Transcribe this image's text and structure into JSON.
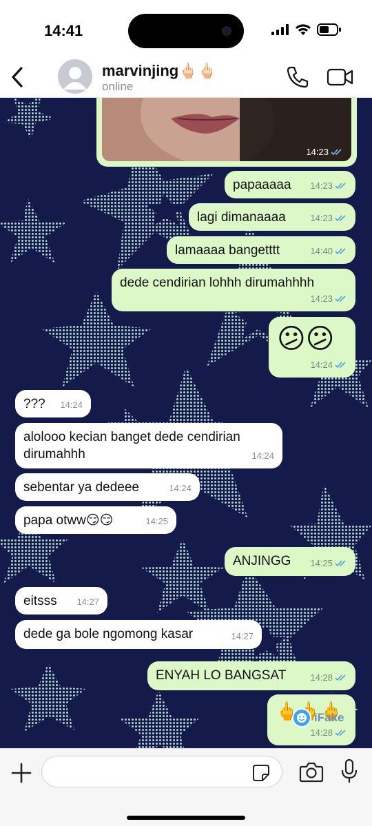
{
  "status_bar": {
    "time": "14:41"
  },
  "header": {
    "contact_name": "marvinjing🖕🏻🖕🏻",
    "contact_status": "online"
  },
  "messages": [
    {
      "dir": "out",
      "type": "photo",
      "time": "14:23"
    },
    {
      "dir": "out",
      "text": "papaaaaa",
      "time": "14:23"
    },
    {
      "dir": "out",
      "text": "lagi dimanaaaa",
      "time": "14:23"
    },
    {
      "dir": "out",
      "text": "lamaaaa bangetttt",
      "time": "14:40"
    },
    {
      "dir": "out",
      "text": "dede cendirian lohhh dirumahhhh",
      "time": "14:23"
    },
    {
      "dir": "out",
      "text": "😕😕",
      "time": "14:24"
    },
    {
      "dir": "in",
      "text": "???",
      "time": "14:24"
    },
    {
      "dir": "in",
      "text_line1": "alolooo kecian banget dede cendirian",
      "text_line2": "dirumahhh",
      "time": "14:24"
    },
    {
      "dir": "in",
      "text": "sebentar ya dedeee",
      "time": "14:24"
    },
    {
      "dir": "in",
      "text": "papa otww😏😏",
      "time": "14:25"
    },
    {
      "dir": "out",
      "text": "ANJINGG",
      "time": "14:25"
    },
    {
      "dir": "in",
      "text": "eitsss",
      "time": "14:27"
    },
    {
      "dir": "in",
      "text": "dede ga bole ngomong kasar",
      "time": "14:27"
    },
    {
      "dir": "out",
      "text": "ENYAH LO BANGSAT",
      "time": "14:28"
    },
    {
      "dir": "out",
      "text": "🖕🖕🖕",
      "time": "14:28"
    }
  ],
  "watermark": {
    "text": "iFake"
  },
  "input": {
    "placeholder": ""
  },
  "colors": {
    "outgoing_bubble": "#dbf8c6",
    "incoming_bubble": "#ffffff",
    "chat_background": "#141a4a",
    "read_ticks": "#4fa3e0"
  }
}
